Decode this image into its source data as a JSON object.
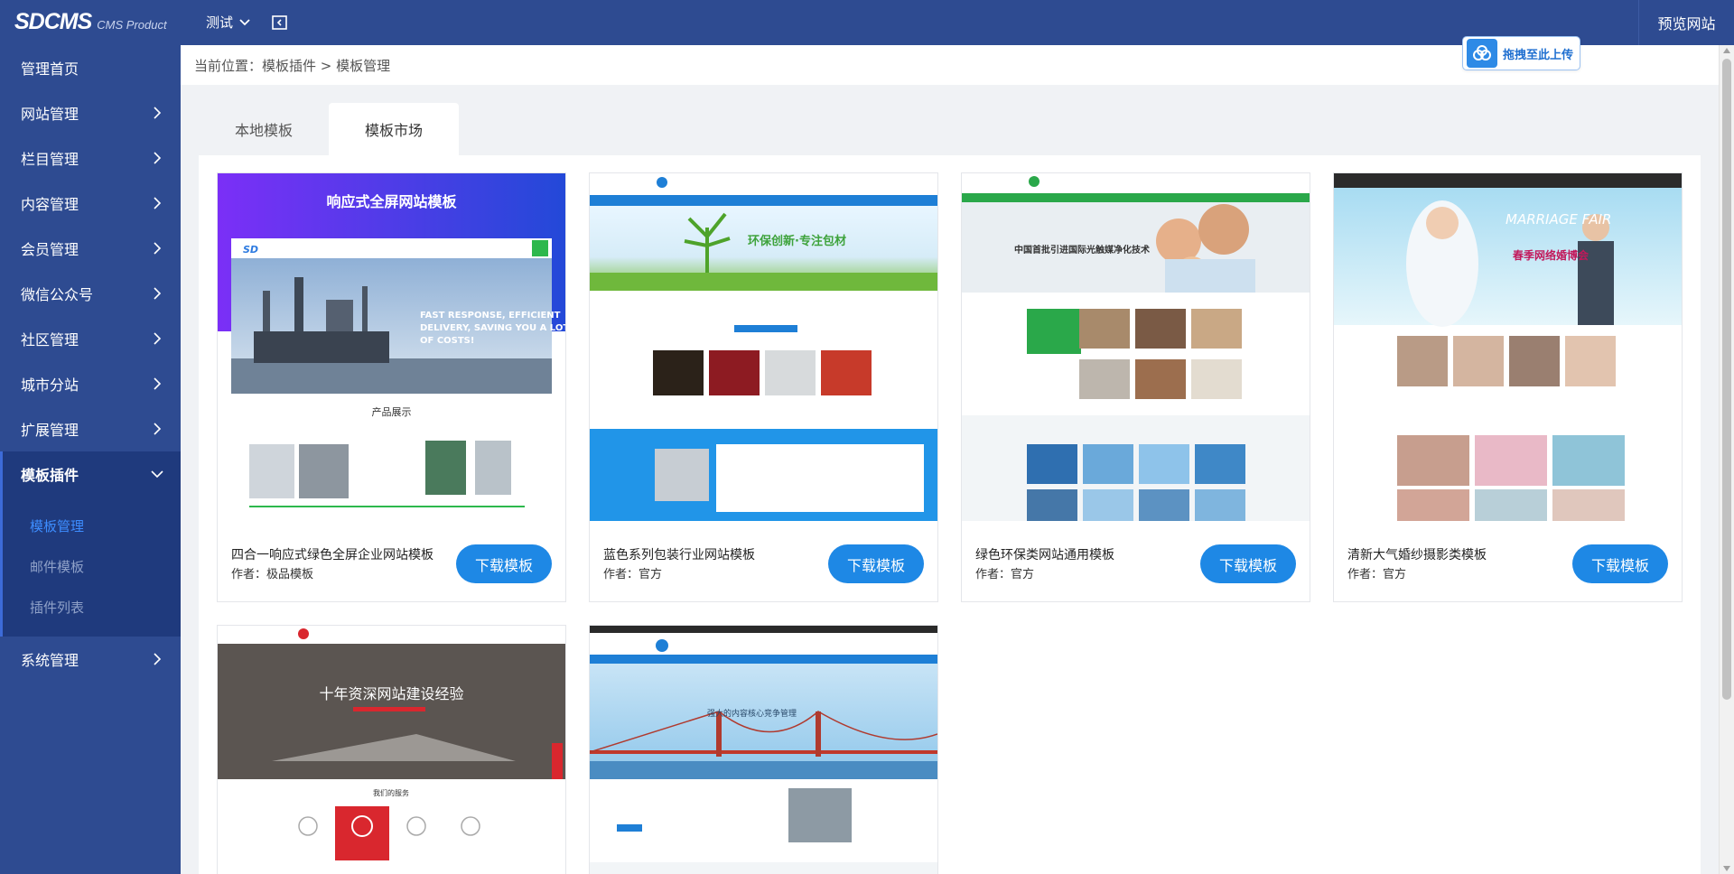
{
  "header": {
    "logo_main": "SDCMS",
    "logo_sub": "CMS Product",
    "site_name": "测试",
    "preview_label": "预览网站"
  },
  "sidebar": {
    "items": [
      {
        "label": "管理首页"
      },
      {
        "label": "网站管理"
      },
      {
        "label": "栏目管理"
      },
      {
        "label": "内容管理"
      },
      {
        "label": "会员管理"
      },
      {
        "label": "微信公众号"
      },
      {
        "label": "社区管理"
      },
      {
        "label": "城市分站"
      },
      {
        "label": "扩展管理"
      },
      {
        "label": "模板插件",
        "sub": [
          "模板管理",
          "邮件模板",
          "插件列表"
        ]
      },
      {
        "label": "系统管理"
      }
    ]
  },
  "breadcrumb": "当前位置：模板插件 > 模板管理",
  "upload_label": "拖拽至此上传",
  "tabs": [
    {
      "label": "本地模板"
    },
    {
      "label": "模板市场"
    }
  ],
  "templates": [
    {
      "title": "四合一响应式绿色全屏企业网站模板",
      "author": "作者：极品模板",
      "button": "下载模板",
      "thumb_headline": "响应式全屏网站模板",
      "thumb_tagline": "FAST RESPONSE, EFFICIENT DELIVERY, SAVING YOU A LOT OF COSTS!",
      "thumb_section": "产品展示"
    },
    {
      "title": "蓝色系列包装行业网站模板",
      "author": "作者：官方",
      "button": "下载模板",
      "thumb_headline": "环保创新·专注包材"
    },
    {
      "title": "绿色环保类网站通用模板",
      "author": "作者：官方",
      "button": "下载模板",
      "thumb_headline": "中国首批引进国际光触媒净化技术"
    },
    {
      "title": "清新大气婚纱摄影类模板",
      "author": "作者：官方",
      "button": "下载模板",
      "thumb_headline": "MARRIAGE FAIR",
      "thumb_tagline": "春季网络婚博会"
    },
    {
      "title": "",
      "author": "",
      "button": "",
      "thumb_headline": "十年资深网站建设经验"
    },
    {
      "title": "",
      "author": "",
      "button": "",
      "thumb_headline": "强大的内容核心竞争管理"
    }
  ]
}
